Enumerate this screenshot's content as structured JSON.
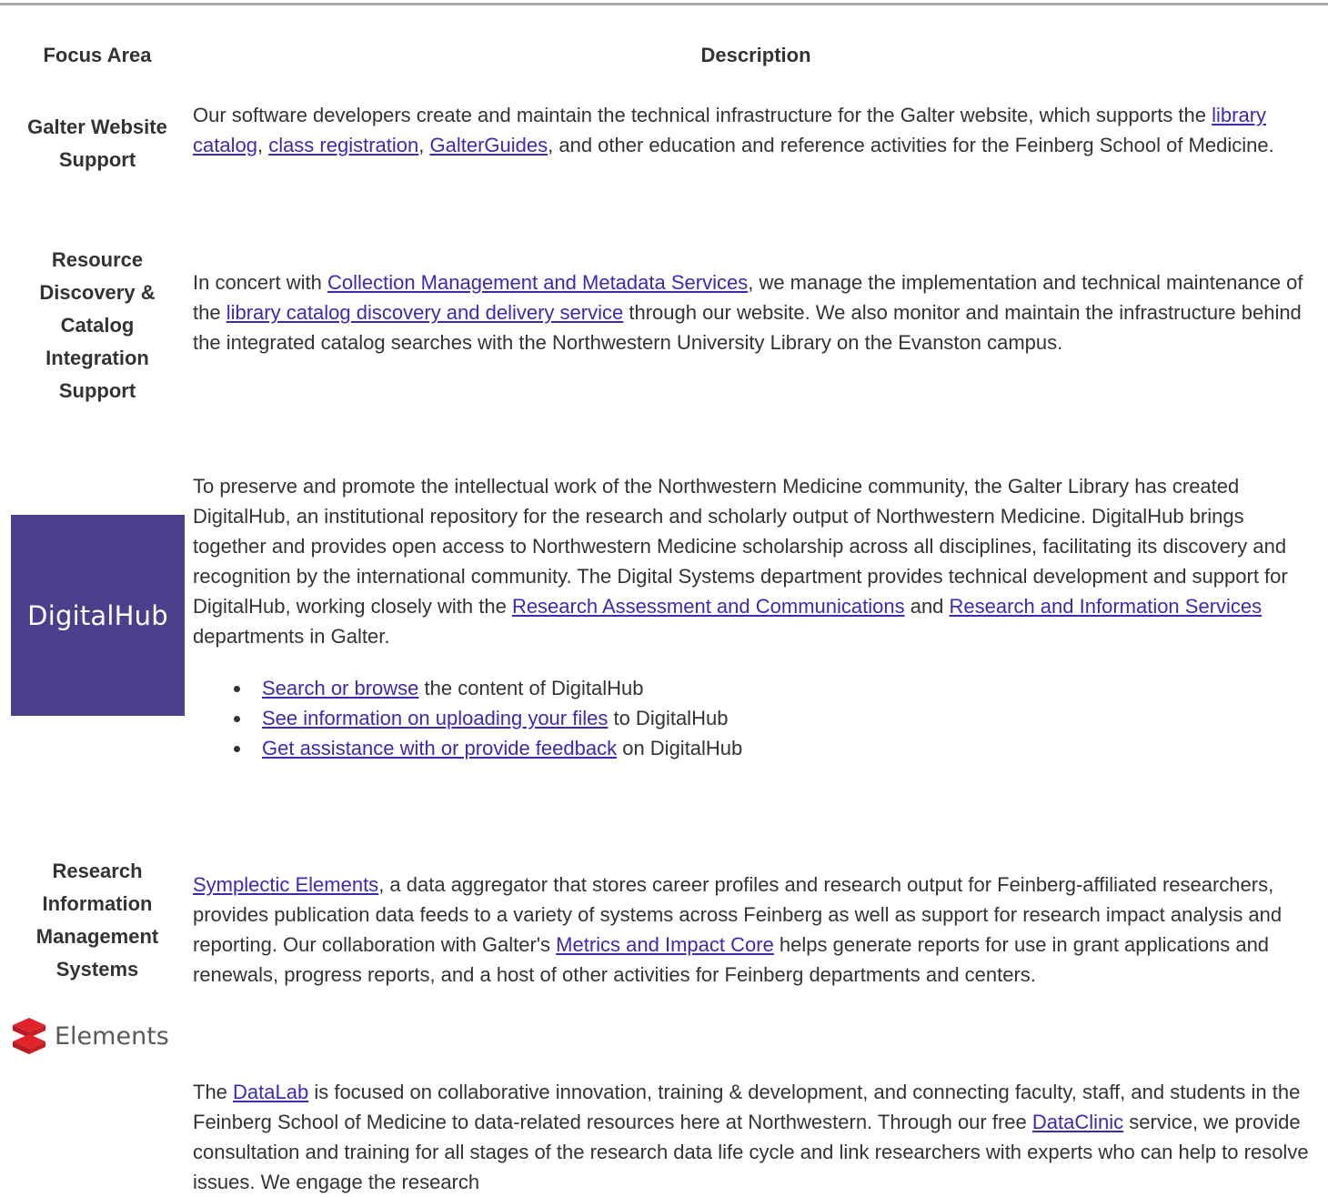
{
  "table": {
    "headers": {
      "focus": "Focus Area",
      "description": "Description"
    }
  },
  "rows": {
    "website": {
      "focus": "Galter Website Support",
      "text": [
        "Our software developers create and maintain the technical infrastructure for the Galter website, which supports the ",
        "library catalog",
        ", ",
        "class registration",
        ", ",
        "GalterGuides",
        ", and other education and reference activities for the Feinberg School of Medicine."
      ]
    },
    "catalog": {
      "focus": "Resource Discovery & Catalog Integration Support",
      "text": [
        "In concert with ",
        "Collection Management and Metadata Services",
        ", we manage the implementation and technical maintenance of the ",
        "library catalog discovery and delivery service",
        " through our website. We also monitor and maintain the infrastructure behind the integrated catalog searches with the Northwestern University Library on the Evanston campus."
      ]
    },
    "digitalhub": {
      "logo_text": "DigitalHub",
      "logo_color": "#4d3e8b",
      "text": [
        "To preserve and promote the intellectual work of the Northwestern Medicine community, the Galter Library has created DigitalHub, an institutional repository for the research and scholarly output of Northwestern Medicine. DigitalHub brings together and provides open access to Northwestern Medicine scholarship across all disciplines, facilitating its discovery and recognition by the international community. The Digital Systems department provides technical development and support for DigitalHub, working closely with the ",
        "Research Assessment and Communications",
        " and ",
        "Research and Information Services",
        " departments in Galter."
      ],
      "list": [
        {
          "link": "Search or browse",
          "rest": " the content of DigitalHub"
        },
        {
          "link": "See information on uploading your files",
          "rest": " to DigitalHub"
        },
        {
          "link": "Get assistance with or provide feedback",
          "rest": " on DigitalHub"
        }
      ]
    },
    "rims": {
      "focus": "Research Information Management Systems",
      "logo_text": "Elements",
      "logo_color": "#e0242a",
      "text": [
        "Symplectic Elements",
        ", a data aggregator that stores career profiles and research output for Feinberg-affiliated researchers, provides publication data feeds to a variety of systems across Feinberg as well as support for research impact analysis and reporting. Our collaboration with Galter's ",
        "Metrics and Impact Core",
        " helps generate reports for use in grant applications and renewals, progress reports, and a host of other activities for Feinberg departments and centers."
      ]
    },
    "datalab": {
      "text": [
        "The ",
        "DataLab",
        " is focused on collaborative innovation, training & development, and connecting faculty, staff, and students in the Feinberg School of Medicine to data-related resources here at Northwestern. Through our free ",
        "DataClinic",
        " service, we provide consultation and training for all stages of the research data life cycle and link researchers with experts who can help to resolve issues. We engage the research"
      ]
    }
  },
  "colors": {
    "text": "#333333",
    "link": "#3b2bb0",
    "rule": "#a9a9a9"
  }
}
